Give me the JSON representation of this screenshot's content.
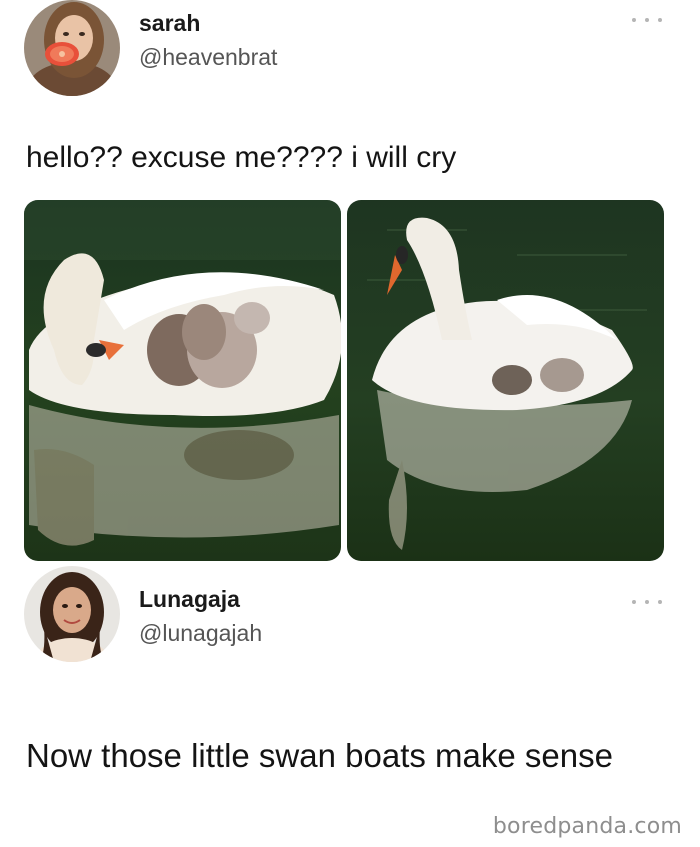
{
  "tweet": {
    "author": {
      "display_name": "sarah",
      "handle": "@heavenbrat"
    },
    "text": "hello?? excuse me???? i will cry",
    "more_icon": "more-horizontal-icon"
  },
  "reply": {
    "author": {
      "display_name": "Lunagaja",
      "handle": "@lunagajah"
    },
    "text": "Now those little swan boats make sense",
    "more_icon": "more-horizontal-icon"
  },
  "watermark": "boredpanda.com",
  "colors": {
    "handle": "#555555",
    "more_dots": "#b5b5b5",
    "pond_water": "#1f3a1e",
    "watermark": "#8e8e8e"
  }
}
